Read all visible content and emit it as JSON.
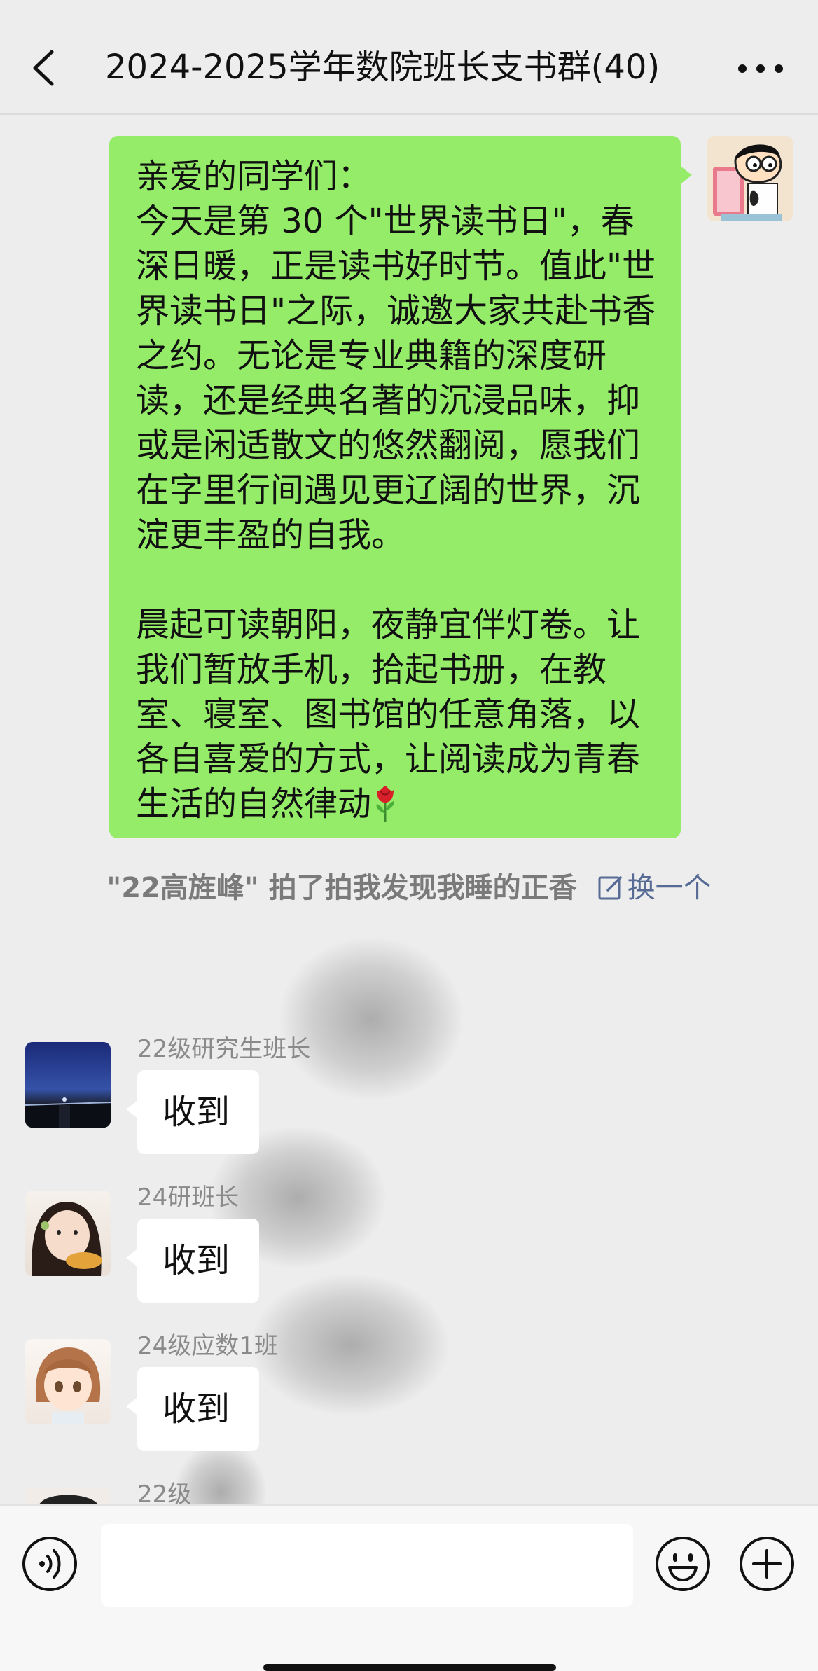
{
  "header": {
    "title": "2024-2025学年数院班长支书群(40)",
    "back_icon": "chevron-left-icon",
    "more_icon": "more-dots-icon"
  },
  "sent_message": {
    "text": "亲爱的同学们：\n今天是第 30 个\"世界读书日\"，春深日暖，正是读书好时节。值此\"世界读书日\"之际，诚邀大家共赴书香之约。无论是专业典籍的深度研读，还是经典名著的沉浸品味，抑或是闲适散文的悠然翻阅，愿我们在字里行间遇见更辽阔的世界，沉淀更丰盈的自我。\n\n晨起可读朝阳，夜静宜伴灯卷。让我们暂放手机，拾起书册，在教室、寝室、图书馆的任意角落，以各自喜爱的方式，让阅读成为青春生活的自然律动",
    "emoji": "rose-emoji",
    "bubble_color": "#95ec69"
  },
  "pat_notice": {
    "text": "\"22高旌峰\" 拍了拍我发现我睡的正香",
    "action_label": "换一个",
    "action_icon": "edit-icon",
    "action_color": "#576b95"
  },
  "messages": [
    {
      "sender": "22级研究生班长",
      "text": "收到"
    },
    {
      "sender": "24研班长",
      "text": "收到"
    },
    {
      "sender": "24级应数1班",
      "text": "收到"
    },
    {
      "sender": "22级",
      "text": ""
    }
  ],
  "input_bar": {
    "voice_icon": "voice-icon",
    "emoji_icon": "emoji-icon",
    "plus_icon": "plus-icon",
    "input_value": ""
  }
}
